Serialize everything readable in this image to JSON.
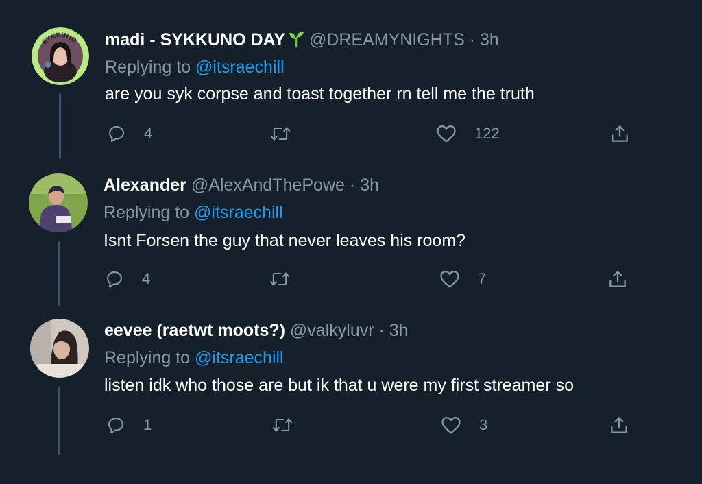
{
  "colors": {
    "background": "#15202b",
    "text_primary": "#ffffff",
    "text_secondary": "#8899a6",
    "link": "#1d9bf0",
    "thread_line": "#3d5466",
    "avatar_ring_green": "#b8e986"
  },
  "tweets": [
    {
      "display_name": "madi - SYKKUNO DAY",
      "name_emoji": "seedling-icon",
      "handle": "@DREAMYNIGHTS",
      "separator": "·",
      "time": "3h",
      "replying_prefix": "Replying to ",
      "replying_to": "@itsraechill",
      "text": "are you syk corpse and toast together rn tell me the truth",
      "avatar_ring_text": "SYKKUNO",
      "replies": "4",
      "retweets": "",
      "likes": "122"
    },
    {
      "display_name": "Alexander",
      "handle": "@AlexAndThePowe",
      "separator": "·",
      "time": "3h",
      "replying_prefix": "Replying to ",
      "replying_to": "@itsraechill",
      "text": "Isnt Forsen the guy that never leaves his room?",
      "replies": "4",
      "retweets": "",
      "likes": "7"
    },
    {
      "display_name": "eevee (raetwt moots?)",
      "handle": "@valkyluvr",
      "separator": "·",
      "time": "3h",
      "replying_prefix": "Replying to ",
      "replying_to": "@itsraechill",
      "text": "listen idk who those are but ik that u were my first streamer so",
      "replies": "1",
      "retweets": "",
      "likes": "3"
    }
  ],
  "icons": {
    "reply": "reply-icon",
    "retweet": "retweet-icon",
    "like": "heart-icon",
    "share": "share-icon"
  }
}
